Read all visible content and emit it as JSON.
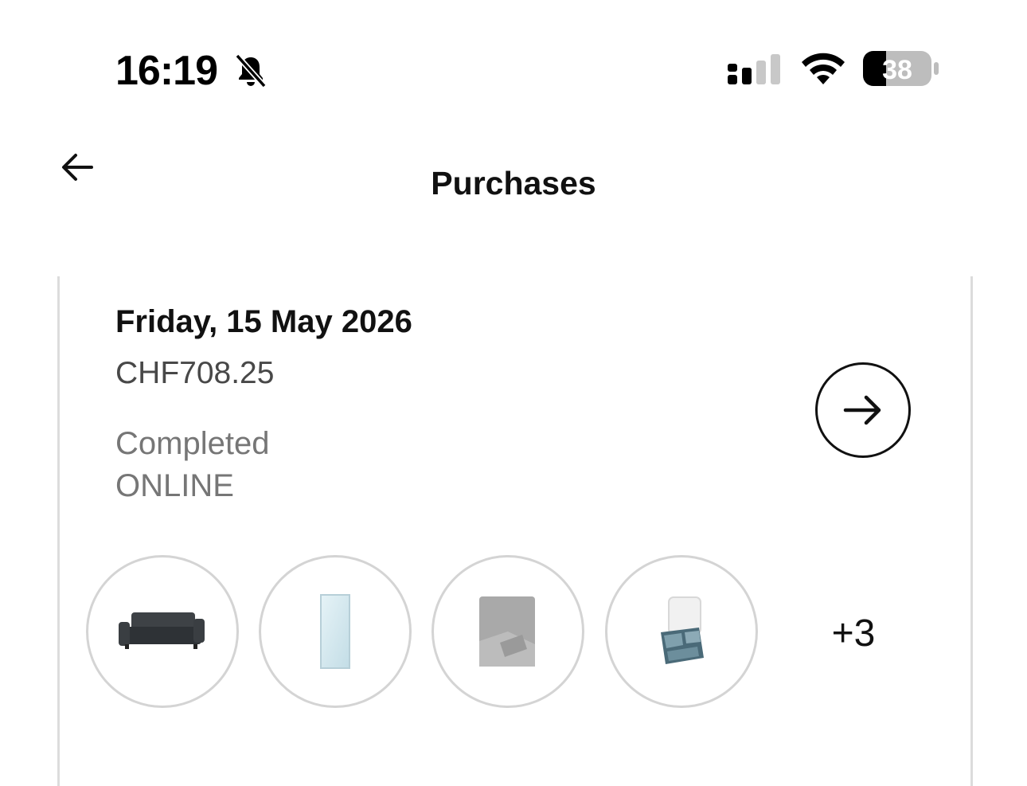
{
  "status_bar": {
    "time": "16:19",
    "battery_level": "38",
    "icons": [
      "bell-muted-icon",
      "cellular-signal-icon",
      "wifi-icon",
      "battery-icon"
    ]
  },
  "header": {
    "title": "Purchases",
    "back_icon": "arrow-left-icon"
  },
  "purchase": {
    "date": "Friday, 15 May 2026",
    "total": "CHF708.25",
    "status": "Completed",
    "channel": "ONLINE",
    "detail_icon": "arrow-right-icon",
    "items": [
      {
        "icon": "sofa-image"
      },
      {
        "icon": "mirror-image"
      },
      {
        "icon": "blanket-image"
      },
      {
        "icon": "storage-box-image"
      }
    ],
    "more_items": "+3"
  },
  "colors": {
    "text_primary": "#111111",
    "text_secondary": "#767676",
    "border": "#dcdcdc"
  }
}
